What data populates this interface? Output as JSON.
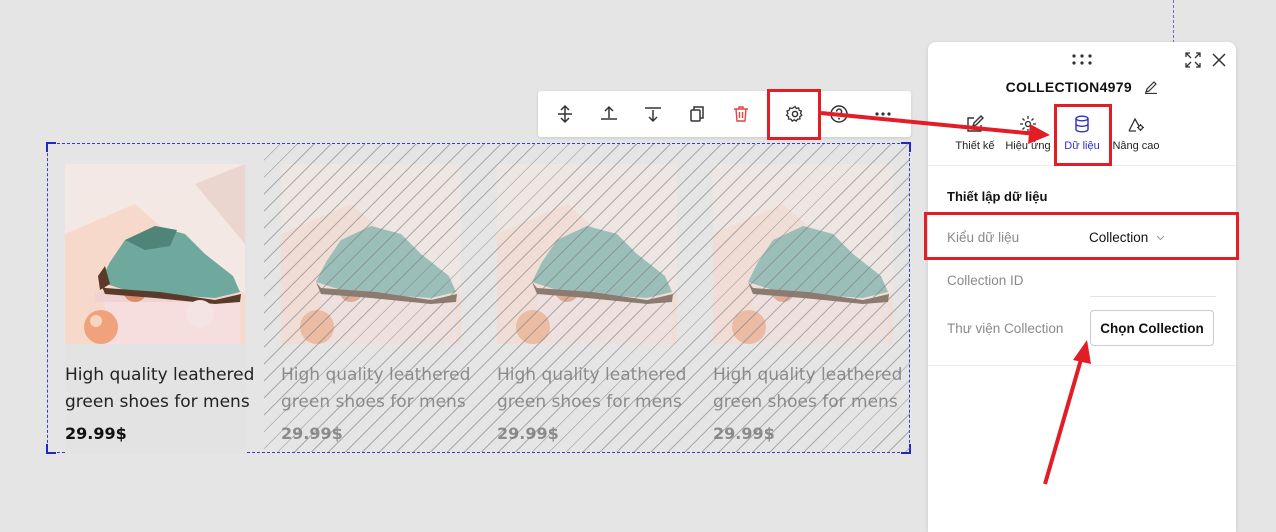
{
  "toolbar": {
    "items": [
      {
        "name": "move-vertical",
        "icon": "arrows-vertical-icon"
      },
      {
        "name": "align-top",
        "icon": "align-top-icon"
      },
      {
        "name": "align-bottom",
        "icon": "align-bottom-icon"
      },
      {
        "name": "duplicate",
        "icon": "copy-icon"
      },
      {
        "name": "delete",
        "icon": "trash-icon"
      },
      {
        "name": "settings",
        "icon": "gear-icon"
      },
      {
        "name": "help",
        "icon": "question-icon"
      },
      {
        "name": "more",
        "icon": "more-horizontal-icon"
      }
    ]
  },
  "products": [
    {
      "title": "High quality leathered green shoes for mens",
      "price": "29.99$"
    },
    {
      "title": "High quality leathered green shoes for mens",
      "price": "29.99$"
    },
    {
      "title": "High quality leathered green shoes for mens",
      "price": "29.99$"
    },
    {
      "title": "High quality leathered green shoes for mens",
      "price": "29.99$"
    }
  ],
  "panel": {
    "name": "COLLECTION4979",
    "tabs": [
      {
        "label": "Thiết kế",
        "icon": "pencil-square-icon"
      },
      {
        "label": "Hiệu ứng",
        "icon": "sparkle-icon"
      },
      {
        "label": "Dữ liệu",
        "icon": "database-icon"
      },
      {
        "label": "Nâng cao",
        "icon": "advanced-settings-icon"
      }
    ],
    "section_title": "Thiết lập dữ liệu",
    "data_type_label": "Kiểu dữ liệu",
    "data_type_value": "Collection",
    "collection_id_label": "Collection ID",
    "library_label": "Thư viện Collection",
    "choose_button": "Chọn Collection"
  },
  "colors": {
    "accent": "#2d2dc9",
    "annotation": "#e21d26",
    "delete": "#e0453f"
  }
}
